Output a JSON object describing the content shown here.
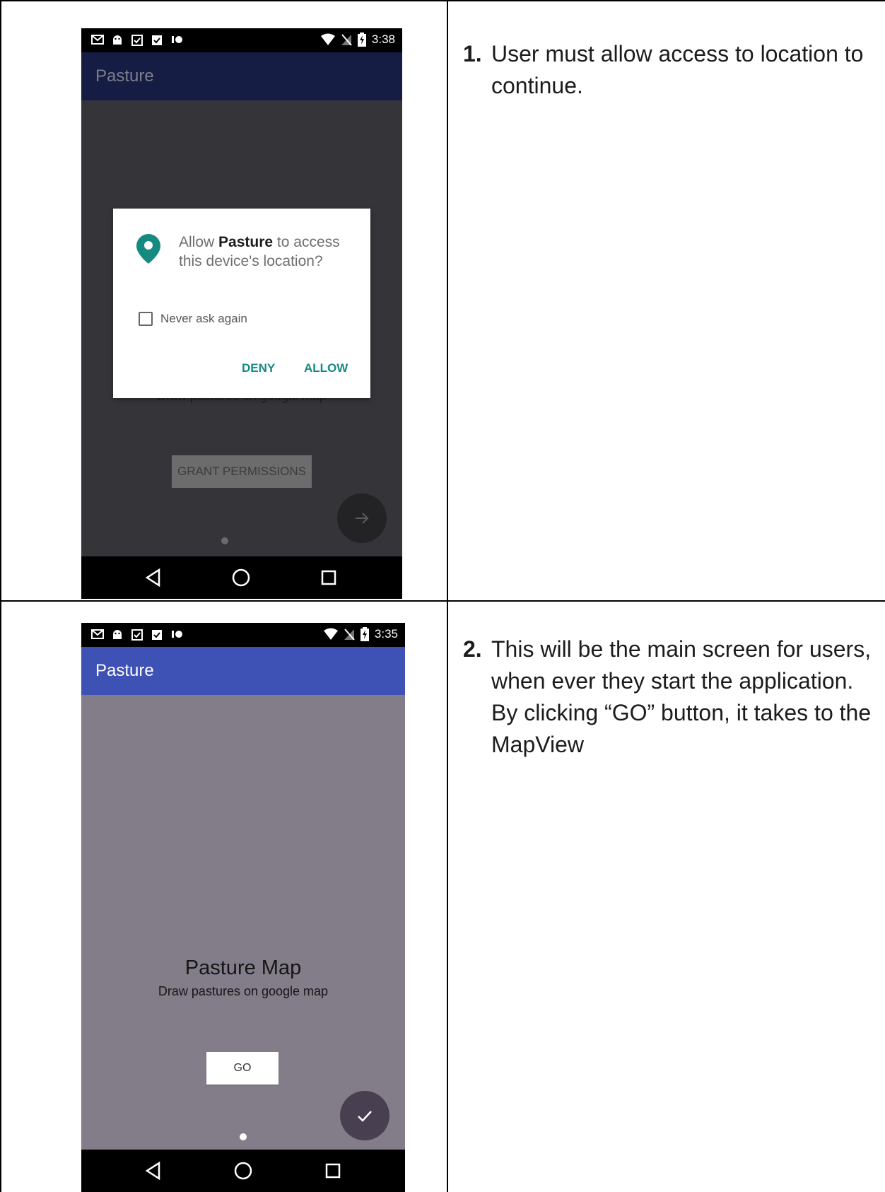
{
  "steps": [
    {
      "number": "1.",
      "text": "User must allow access to location to continue."
    },
    {
      "number": "2.",
      "text": "This will be the main screen for users, when ever they start the application. By clicking “GO” button, it takes to the MapView"
    }
  ],
  "screen1": {
    "time": "3:38",
    "app_title": "Pasture",
    "background_subtitle": "Draw pastures on google map",
    "grant_button": "GRANT PERMISSIONS",
    "dialog": {
      "message_prefix": "Allow ",
      "message_app": "Pasture",
      "message_suffix": " to access this device's location?",
      "checkbox_label": "Never ask again",
      "deny": "DENY",
      "allow": "ALLOW"
    }
  },
  "screen2": {
    "time": "3:35",
    "app_title": "Pasture",
    "title": "Pasture Map",
    "subtitle": "Draw pastures on google map",
    "go_button": "GO"
  },
  "colors": {
    "accent_teal": "#148a80",
    "appbar_blue": "#3e51b5",
    "dim_appbar": "#151d45"
  }
}
